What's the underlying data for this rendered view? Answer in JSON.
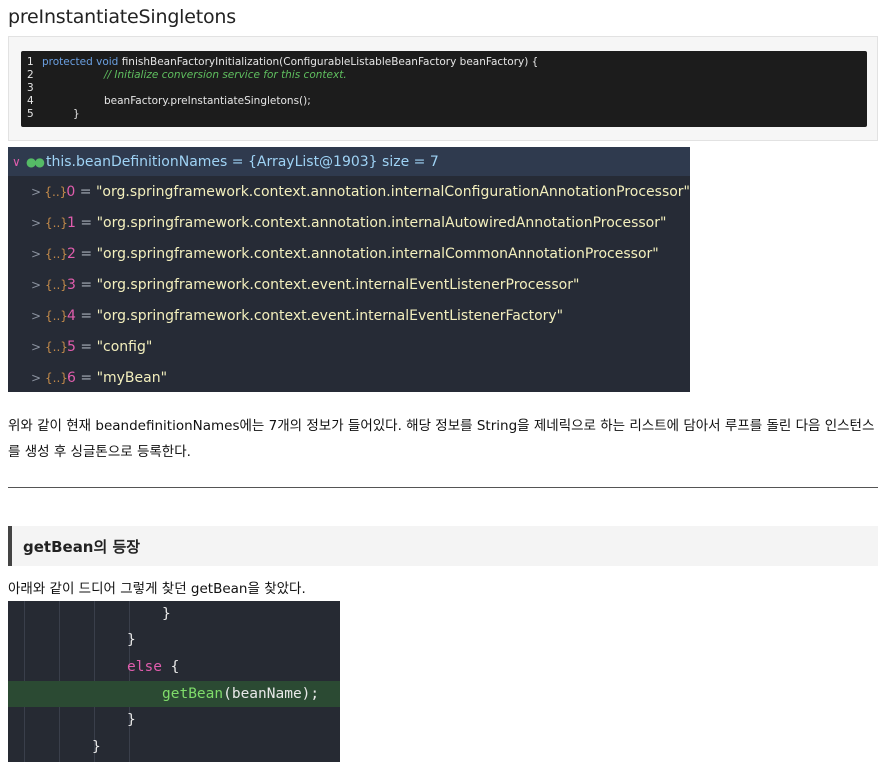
{
  "title": "preInstantiateSingletons",
  "code": {
    "lines": [
      {
        "num": "1",
        "kw1": "protected",
        "kw2": "void",
        "text": " finishBeanFactoryInitialization(ConfigurableListableBeanFactory beanFactory) {"
      },
      {
        "num": "2",
        "comment": "// Initialize conversion service for this context."
      },
      {
        "num": "3",
        "text": ""
      },
      {
        "num": "4",
        "text": "beanFactory.preInstantiateSingletons();"
      },
      {
        "num": "5",
        "text": "}"
      }
    ]
  },
  "debugger": {
    "header": "this.beanDefinitionNames = {ArrayList@1903}  size = 7",
    "items": [
      {
        "index": "0",
        "value": "\"org.springframework.context.annotation.internalConfigurationAnnotationProcessor\""
      },
      {
        "index": "1",
        "value": "\"org.springframework.context.annotation.internalAutowiredAnnotationProcessor\""
      },
      {
        "index": "2",
        "value": "\"org.springframework.context.annotation.internalCommonAnnotationProcessor\""
      },
      {
        "index": "3",
        "value": "\"org.springframework.context.event.internalEventListenerProcessor\""
      },
      {
        "index": "4",
        "value": "\"org.springframework.context.event.internalEventListenerFactory\""
      },
      {
        "index": "5",
        "value": "\"config\""
      },
      {
        "index": "6",
        "value": "\"myBean\""
      }
    ]
  },
  "paragraph": "위와 같이 현재 beandefinitionNames에는 7개의 정보가 들어있다. 해당 정보를 String을 제네릭으로 하는 리스트에 담아서 루프를 돌린 다음 인스턴스를 생성 후 싱글톤으로 등록한다.",
  "section_heading": "getBean의 등장",
  "paragraph2": "아래와 같이 드디어 그렇게 찾던 getBean을 찾았다.",
  "code2": {
    "brace_close": "}",
    "else_kw": "else",
    "open_brace": " {",
    "fn": "getBean",
    "args": "(beanName);"
  },
  "colors": {
    "debugger_bg": "#262b36",
    "string": "#f3efbd",
    "index": "#e05dad",
    "highlight_line": "#2b4a33"
  }
}
